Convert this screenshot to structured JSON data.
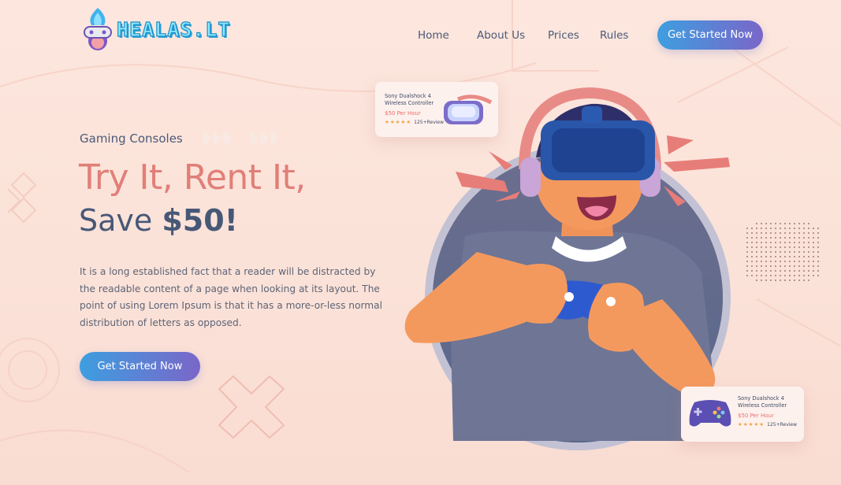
{
  "brand": {
    "name": "HEALAS.LT"
  },
  "nav": {
    "items": [
      "Home",
      "About Us",
      "Prices",
      "Rules"
    ],
    "cta": "Get Started Now"
  },
  "hero": {
    "eyebrow": "Gaming Consoles",
    "title_line1": "Try It, Rent It,",
    "title_line2_prefix": "Save ",
    "title_line2_bold": "$50!",
    "paragraph": "It is a long established fact that a reader will be distracted by the readable content of a page when looking at its layout. The point of using Lorem Ipsum is that it has a more-or-less normal distribution of letters as opposed.",
    "cta": "Get Started Now"
  },
  "cards": [
    {
      "title_line1": "Sony Dualshock 4",
      "title_line2": "Wireless Controller",
      "price": "$50 Per Hour",
      "stars": "★★★★★",
      "reviews": "125+Review",
      "icon": "vr-headset-icon"
    },
    {
      "title_line1": "Sony Dualshock 4",
      "title_line2": "Wireless Controller",
      "price": "$50 Per Hour",
      "stars": "★★★★★",
      "reviews": "125+Review",
      "icon": "gamepad-icon"
    }
  ],
  "colors": {
    "accent_coral": "#e07f78",
    "heading_navy": "#475877",
    "gradient_start": "#3e9ee0",
    "gradient_end": "#7a66c8",
    "background": "#fce6de"
  }
}
